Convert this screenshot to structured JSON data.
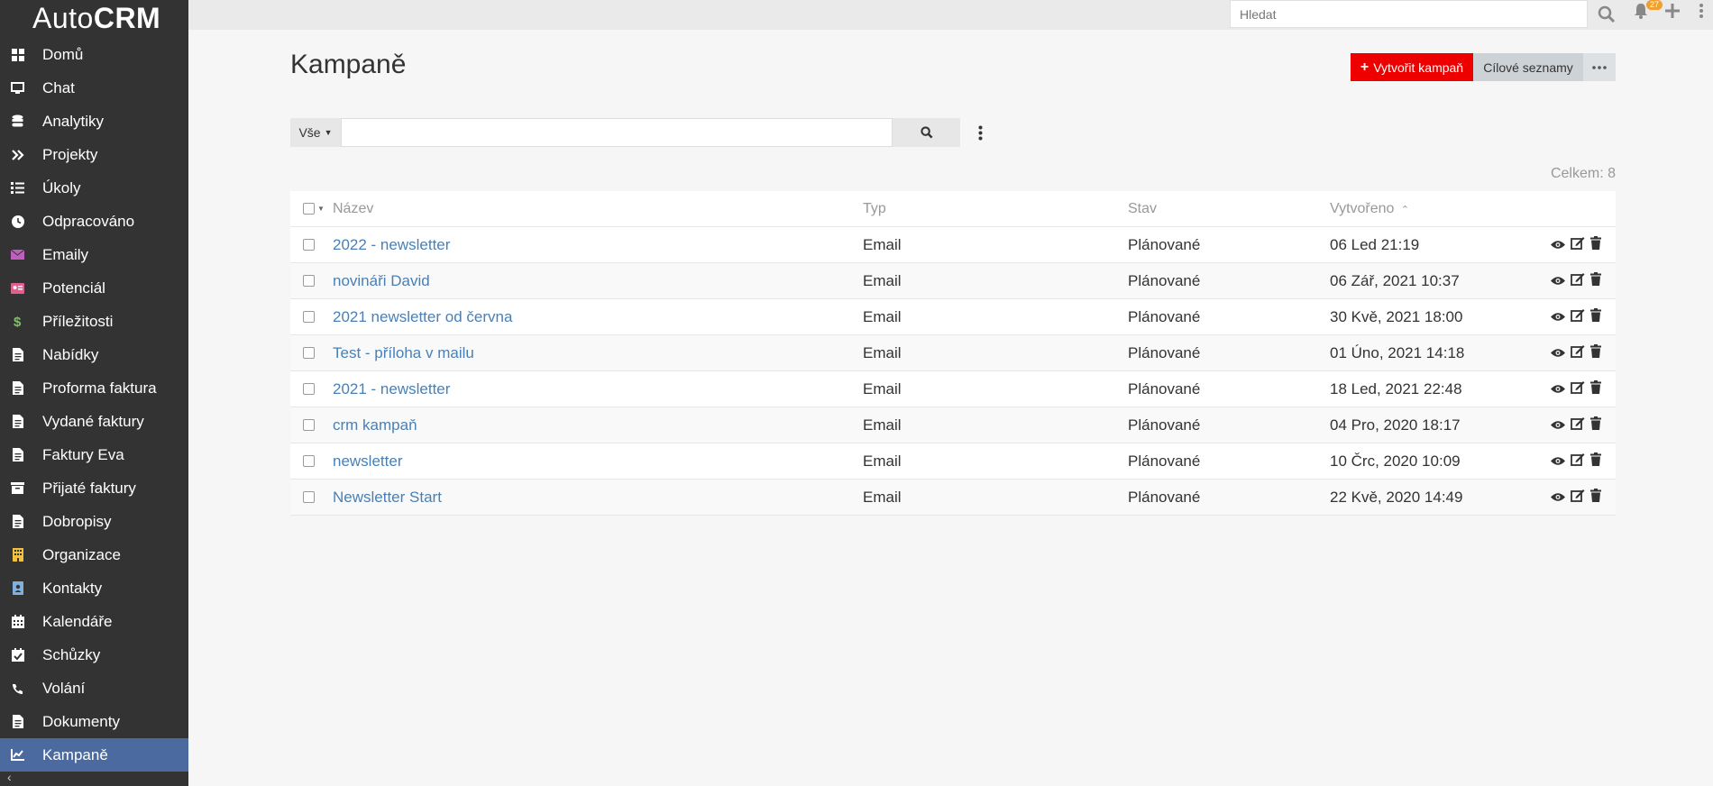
{
  "app": {
    "brand_light": "Auto",
    "brand_bold": "CRM"
  },
  "sidebar": {
    "items": [
      {
        "label": "Domů",
        "icon": "dashboard-icon",
        "color": "#ffffff"
      },
      {
        "label": "Chat",
        "icon": "monitor-icon",
        "color": "#ffffff"
      },
      {
        "label": "Analytiky",
        "icon": "database-icon",
        "color": "#ffffff"
      },
      {
        "label": "Projekty",
        "icon": "double-chevron-icon",
        "color": "#ffffff"
      },
      {
        "label": "Úkoly",
        "icon": "tasks-icon",
        "color": "#ffffff"
      },
      {
        "label": "Odpracováno",
        "icon": "clock-icon",
        "color": "#ffffff"
      },
      {
        "label": "Emaily",
        "icon": "envelope-icon",
        "color": "#c05ec0"
      },
      {
        "label": "Potenciál",
        "icon": "id-card-icon",
        "color": "#e05f8f"
      },
      {
        "label": "Příležitosti",
        "icon": "dollar-icon",
        "color": "#7fc06a"
      },
      {
        "label": "Nabídky",
        "icon": "document-icon",
        "color": "#ffffff"
      },
      {
        "label": "Proforma faktura",
        "icon": "document-icon",
        "color": "#ffffff"
      },
      {
        "label": "Vydané faktury",
        "icon": "document-icon",
        "color": "#ffffff"
      },
      {
        "label": "Faktury Eva",
        "icon": "document-icon",
        "color": "#ffffff"
      },
      {
        "label": "Přijaté faktury",
        "icon": "archive-icon",
        "color": "#ffffff"
      },
      {
        "label": "Dobropisy",
        "icon": "document-icon",
        "color": "#ffffff"
      },
      {
        "label": "Organizace",
        "icon": "building-icon",
        "color": "#f0c040"
      },
      {
        "label": "Kontakty",
        "icon": "contact-card-icon",
        "color": "#7fb0e0"
      },
      {
        "label": "Kalendáře",
        "icon": "calendar-icon",
        "color": "#ffffff"
      },
      {
        "label": "Schůzky",
        "icon": "calendar-check-icon",
        "color": "#ffffff"
      },
      {
        "label": "Volání",
        "icon": "phone-icon",
        "color": "#ffffff"
      },
      {
        "label": "Dokumenty",
        "icon": "document-icon",
        "color": "#ffffff"
      },
      {
        "label": "Kampaně",
        "icon": "chart-line-icon",
        "color": "#ffffff",
        "active": true
      }
    ]
  },
  "topbar": {
    "search_placeholder": "Hledat",
    "notification_count": "27"
  },
  "page": {
    "title": "Kampaně",
    "create_button": "Vytvořit kampaň",
    "target_lists_button": "Cílové seznamy",
    "filter_label": "Vše",
    "total_label": "Celkem: 8"
  },
  "table": {
    "columns": [
      "Název",
      "Typ",
      "Stav",
      "Vytvořeno"
    ],
    "rows": [
      {
        "name": "2022 - newsletter",
        "type": "Email",
        "state": "Plánované",
        "created": "06 Led 21:19"
      },
      {
        "name": "novináři David",
        "type": "Email",
        "state": "Plánované",
        "created": "06 Zář, 2021 10:37"
      },
      {
        "name": "2021 newsletter od června",
        "type": "Email",
        "state": "Plánované",
        "created": "30 Kvě, 2021 18:00"
      },
      {
        "name": "Test - příloha v mailu",
        "type": "Email",
        "state": "Plánované",
        "created": "01 Úno, 2021 14:18"
      },
      {
        "name": "2021 - newsletter",
        "type": "Email",
        "state": "Plánované",
        "created": "18 Led, 2021 22:48"
      },
      {
        "name": "crm kampaň",
        "type": "Email",
        "state": "Plánované",
        "created": "04 Pro, 2020 18:17"
      },
      {
        "name": "newsletter",
        "type": "Email",
        "state": "Plánované",
        "created": "10 Črc, 2020 10:09"
      },
      {
        "name": "Newsletter Start",
        "type": "Email",
        "state": "Plánované",
        "created": "22 Kvě, 2020 14:49"
      }
    ]
  },
  "colors": {
    "accent_red": "#ee0000",
    "sidebar_bg": "#333333",
    "link": "#4a80b4",
    "active_nav": "#4a6aa0"
  }
}
